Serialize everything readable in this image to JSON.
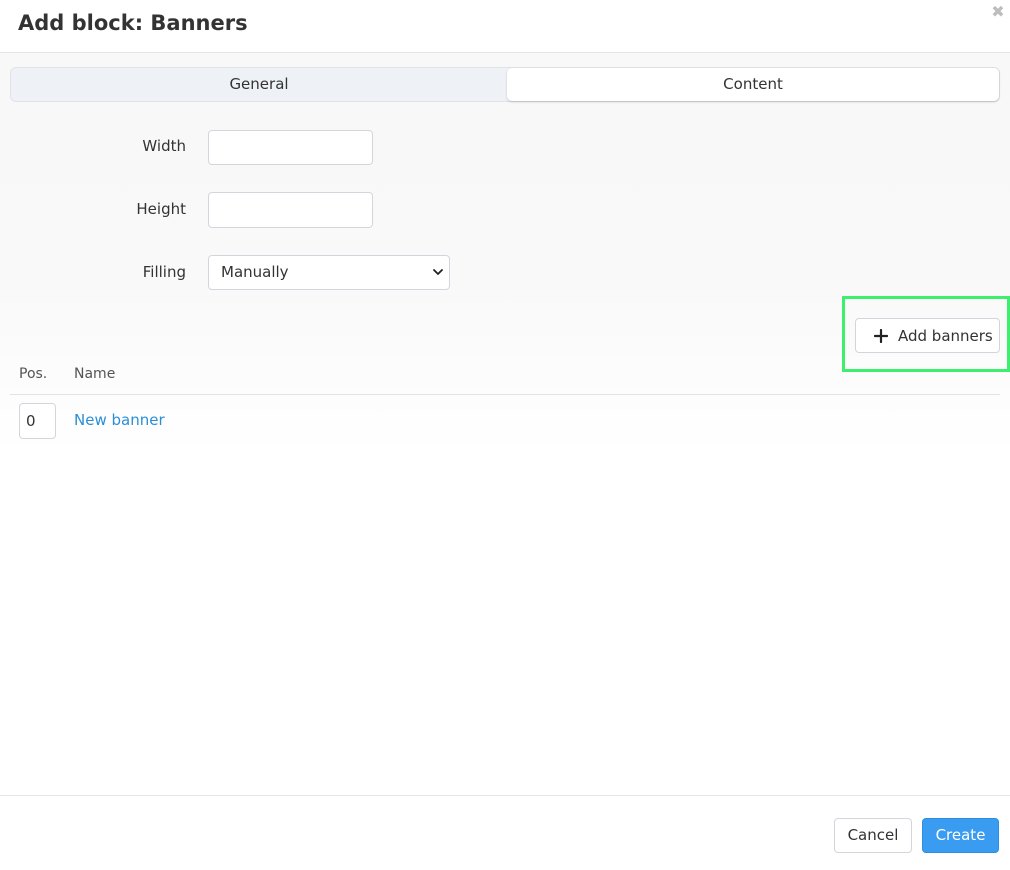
{
  "modal": {
    "title": "Add block: Banners",
    "close_symbol": "✖"
  },
  "tabs": [
    {
      "label": "General",
      "active": false
    },
    {
      "label": "Content",
      "active": true
    }
  ],
  "form": {
    "width_label": "Width",
    "width_value": "",
    "height_label": "Height",
    "height_value": "",
    "filling_label": "Filling",
    "filling_value": "Manually"
  },
  "banners": {
    "add_button_label": "Add banners",
    "add_button_icon": "plus-icon",
    "columns": [
      "Pos.",
      "Name"
    ],
    "rows": [
      {
        "pos": "0",
        "name": "New banner"
      }
    ]
  },
  "footer": {
    "cancel_label": "Cancel",
    "create_label": "Create"
  },
  "colors": {
    "accent": "#3a9cf0",
    "link": "#2b8fd6",
    "highlight": "#3cf06e"
  }
}
